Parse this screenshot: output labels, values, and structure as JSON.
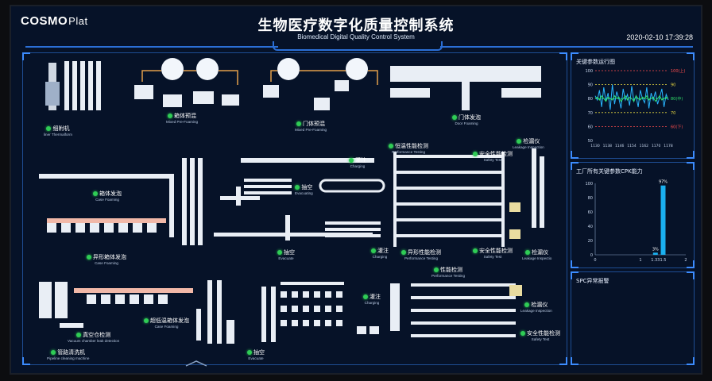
{
  "header": {
    "logo_main": "COSMO",
    "logo_sub": "Plat",
    "title_cn": "生物医疗数字化质量控制系统",
    "title_en": "Biomedical Digital Quality Control System",
    "datetime": "2020-02-10 17:39:28"
  },
  "stations": [
    {
      "cn": "细附机",
      "en": "liner Thermalform"
    },
    {
      "cn": "箱体预混",
      "en": "Mixed Pre-Foaming"
    },
    {
      "cn": "门体预混",
      "en": "Mixed Pre-Foaming"
    },
    {
      "cn": "门体发泡",
      "en": "Door Foaming"
    },
    {
      "cn": "箱体发泡",
      "en": "Case Foaming"
    },
    {
      "cn": "恒温性能检测",
      "en": "Performance Testing"
    },
    {
      "cn": "灌注",
      "en": "Charging"
    },
    {
      "cn": "安全性能检测",
      "en": "Safety Test"
    },
    {
      "cn": "检漏仪",
      "en": "Leakage Inspection"
    },
    {
      "cn": "抽空",
      "en": "Evacuating"
    },
    {
      "cn": "异形箱体发泡",
      "en": "Case Foaming"
    },
    {
      "cn": "抽空",
      "en": "Evacuate"
    },
    {
      "cn": "灌注",
      "en": "Charging"
    },
    {
      "cn": "异形性能检测",
      "en": "Performance Testing"
    },
    {
      "cn": "安全性能检测",
      "en": "Safety Test"
    },
    {
      "cn": "检漏仪",
      "en": "Leakage Inspectio"
    },
    {
      "cn": "真空仓检测",
      "en": "Vacuum chamber leak detection"
    },
    {
      "cn": "超低温箱体发泡",
      "en": "Case Foaming"
    },
    {
      "cn": "管路清洗机",
      "en": "Pipeline cleaning machine"
    },
    {
      "cn": "性能检测",
      "en": "Performance Testing"
    },
    {
      "cn": "灌注",
      "en": "Charging"
    },
    {
      "cn": "检漏仪",
      "en": "Leakage Inspection"
    },
    {
      "cn": "安全性能检测",
      "en": "Safety Test"
    },
    {
      "cn": "抽空",
      "en": "Evacuate"
    }
  ],
  "panels": {
    "key_params": {
      "title": "关键参数运行图",
      "y_ticks": [
        "100",
        "90",
        "80",
        "70",
        "60",
        "50"
      ],
      "x_ticks": [
        "1130",
        "1138",
        "1146",
        "1154",
        "1162",
        "1170",
        "1178"
      ],
      "markers": [
        "100(上)",
        "90",
        "80(中)",
        "70",
        "60(下)"
      ]
    },
    "cpk": {
      "title": "工厂所有关键参数CPK能力",
      "y_ticks": [
        "100",
        "80",
        "60",
        "40",
        "20",
        "0"
      ],
      "x_ticks": [
        "0",
        "1",
        "1.33",
        "1.5",
        "2"
      ],
      "bar_labels": [
        "97%",
        "3%"
      ]
    },
    "spc": {
      "title": "SPC异常报警"
    }
  },
  "chart_data": [
    {
      "type": "line",
      "title": "关键参数运行图",
      "ylim": [
        50,
        100
      ],
      "x_ticks": [
        1130,
        1138,
        1146,
        1154,
        1162,
        1170,
        1178
      ],
      "reference_lines": [
        100,
        90,
        80,
        70,
        60
      ],
      "series": [
        {
          "values": [
            82,
            79,
            86,
            74,
            88,
            78,
            84,
            72,
            90,
            76,
            85,
            80,
            73,
            87,
            79,
            83,
            75,
            89,
            78,
            82,
            74,
            86,
            80,
            77,
            88,
            73,
            84,
            79,
            85,
            76,
            81,
            87,
            74,
            83,
            79
          ],
          "color": "#29b6ff"
        },
        {
          "values": [
            80,
            81,
            79,
            82,
            80,
            78,
            81,
            80,
            79,
            82,
            80,
            81,
            78,
            80,
            82,
            79,
            81,
            80,
            78,
            82,
            80,
            79,
            81,
            80,
            82,
            79,
            80,
            81,
            78,
            80,
            82,
            79,
            80,
            81,
            80
          ],
          "color": "#2fe06a"
        }
      ]
    },
    {
      "type": "bar",
      "title": "工厂所有关键参数CPK能力",
      "categories": [
        "1.33",
        "1.5"
      ],
      "values": [
        3,
        97
      ],
      "ylim": [
        0,
        100
      ],
      "x_ticks": [
        0,
        1,
        1.33,
        1.5,
        2
      ],
      "color": "#1ab0f0"
    }
  ]
}
